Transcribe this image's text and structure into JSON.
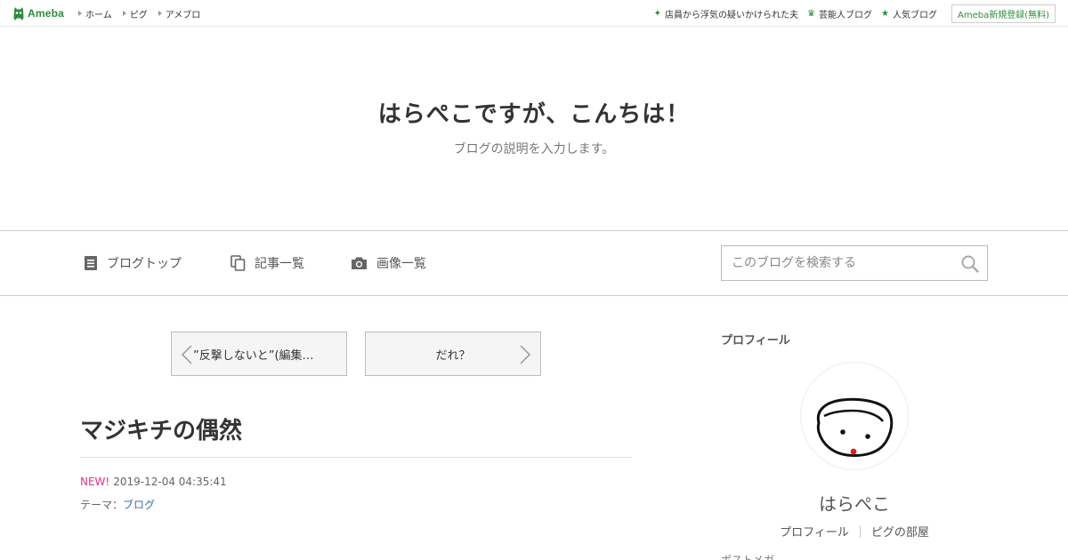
{
  "topbar": {
    "logo": "Ameba",
    "nav": [
      "ホーム",
      "ピグ",
      "アメブロ"
    ],
    "right_links": [
      {
        "label": "店員から浮気の疑いかけられた夫",
        "icon": "sparkle-icon"
      },
      {
        "label": "芸能人ブログ",
        "icon": "crown-icon"
      },
      {
        "label": "人気ブログ",
        "icon": "star-icon"
      }
    ],
    "signup": "Ameba新規登録(無料)"
  },
  "header": {
    "title": "はらぺこですが、こんちは！",
    "description": "ブログの説明を入力します。"
  },
  "gnav": {
    "items": [
      {
        "label": "ブログトップ",
        "icon": "document-icon"
      },
      {
        "label": "記事一覧",
        "icon": "copy-icon"
      },
      {
        "label": "画像一覧",
        "icon": "camera-icon"
      }
    ],
    "search_placeholder": "このブログを検索する"
  },
  "pager": {
    "prev": "”反撃しないと”(編集…",
    "next": "だれ？"
  },
  "entry": {
    "title": "マジキチの偶然",
    "new_badge": "NEW!",
    "datetime": "2019-12-04 04:35:41",
    "theme_label": "テーマ：",
    "theme": "ブログ"
  },
  "sidebar": {
    "heading": "プロフィール",
    "name": "はらぺこ",
    "links": [
      "プロフィール",
      "ピグの部屋"
    ],
    "cut_text": "ポストメガ"
  },
  "colors": {
    "brand": "#2d8c3c",
    "new": "#e0338a",
    "link": "#3b6eb5"
  }
}
